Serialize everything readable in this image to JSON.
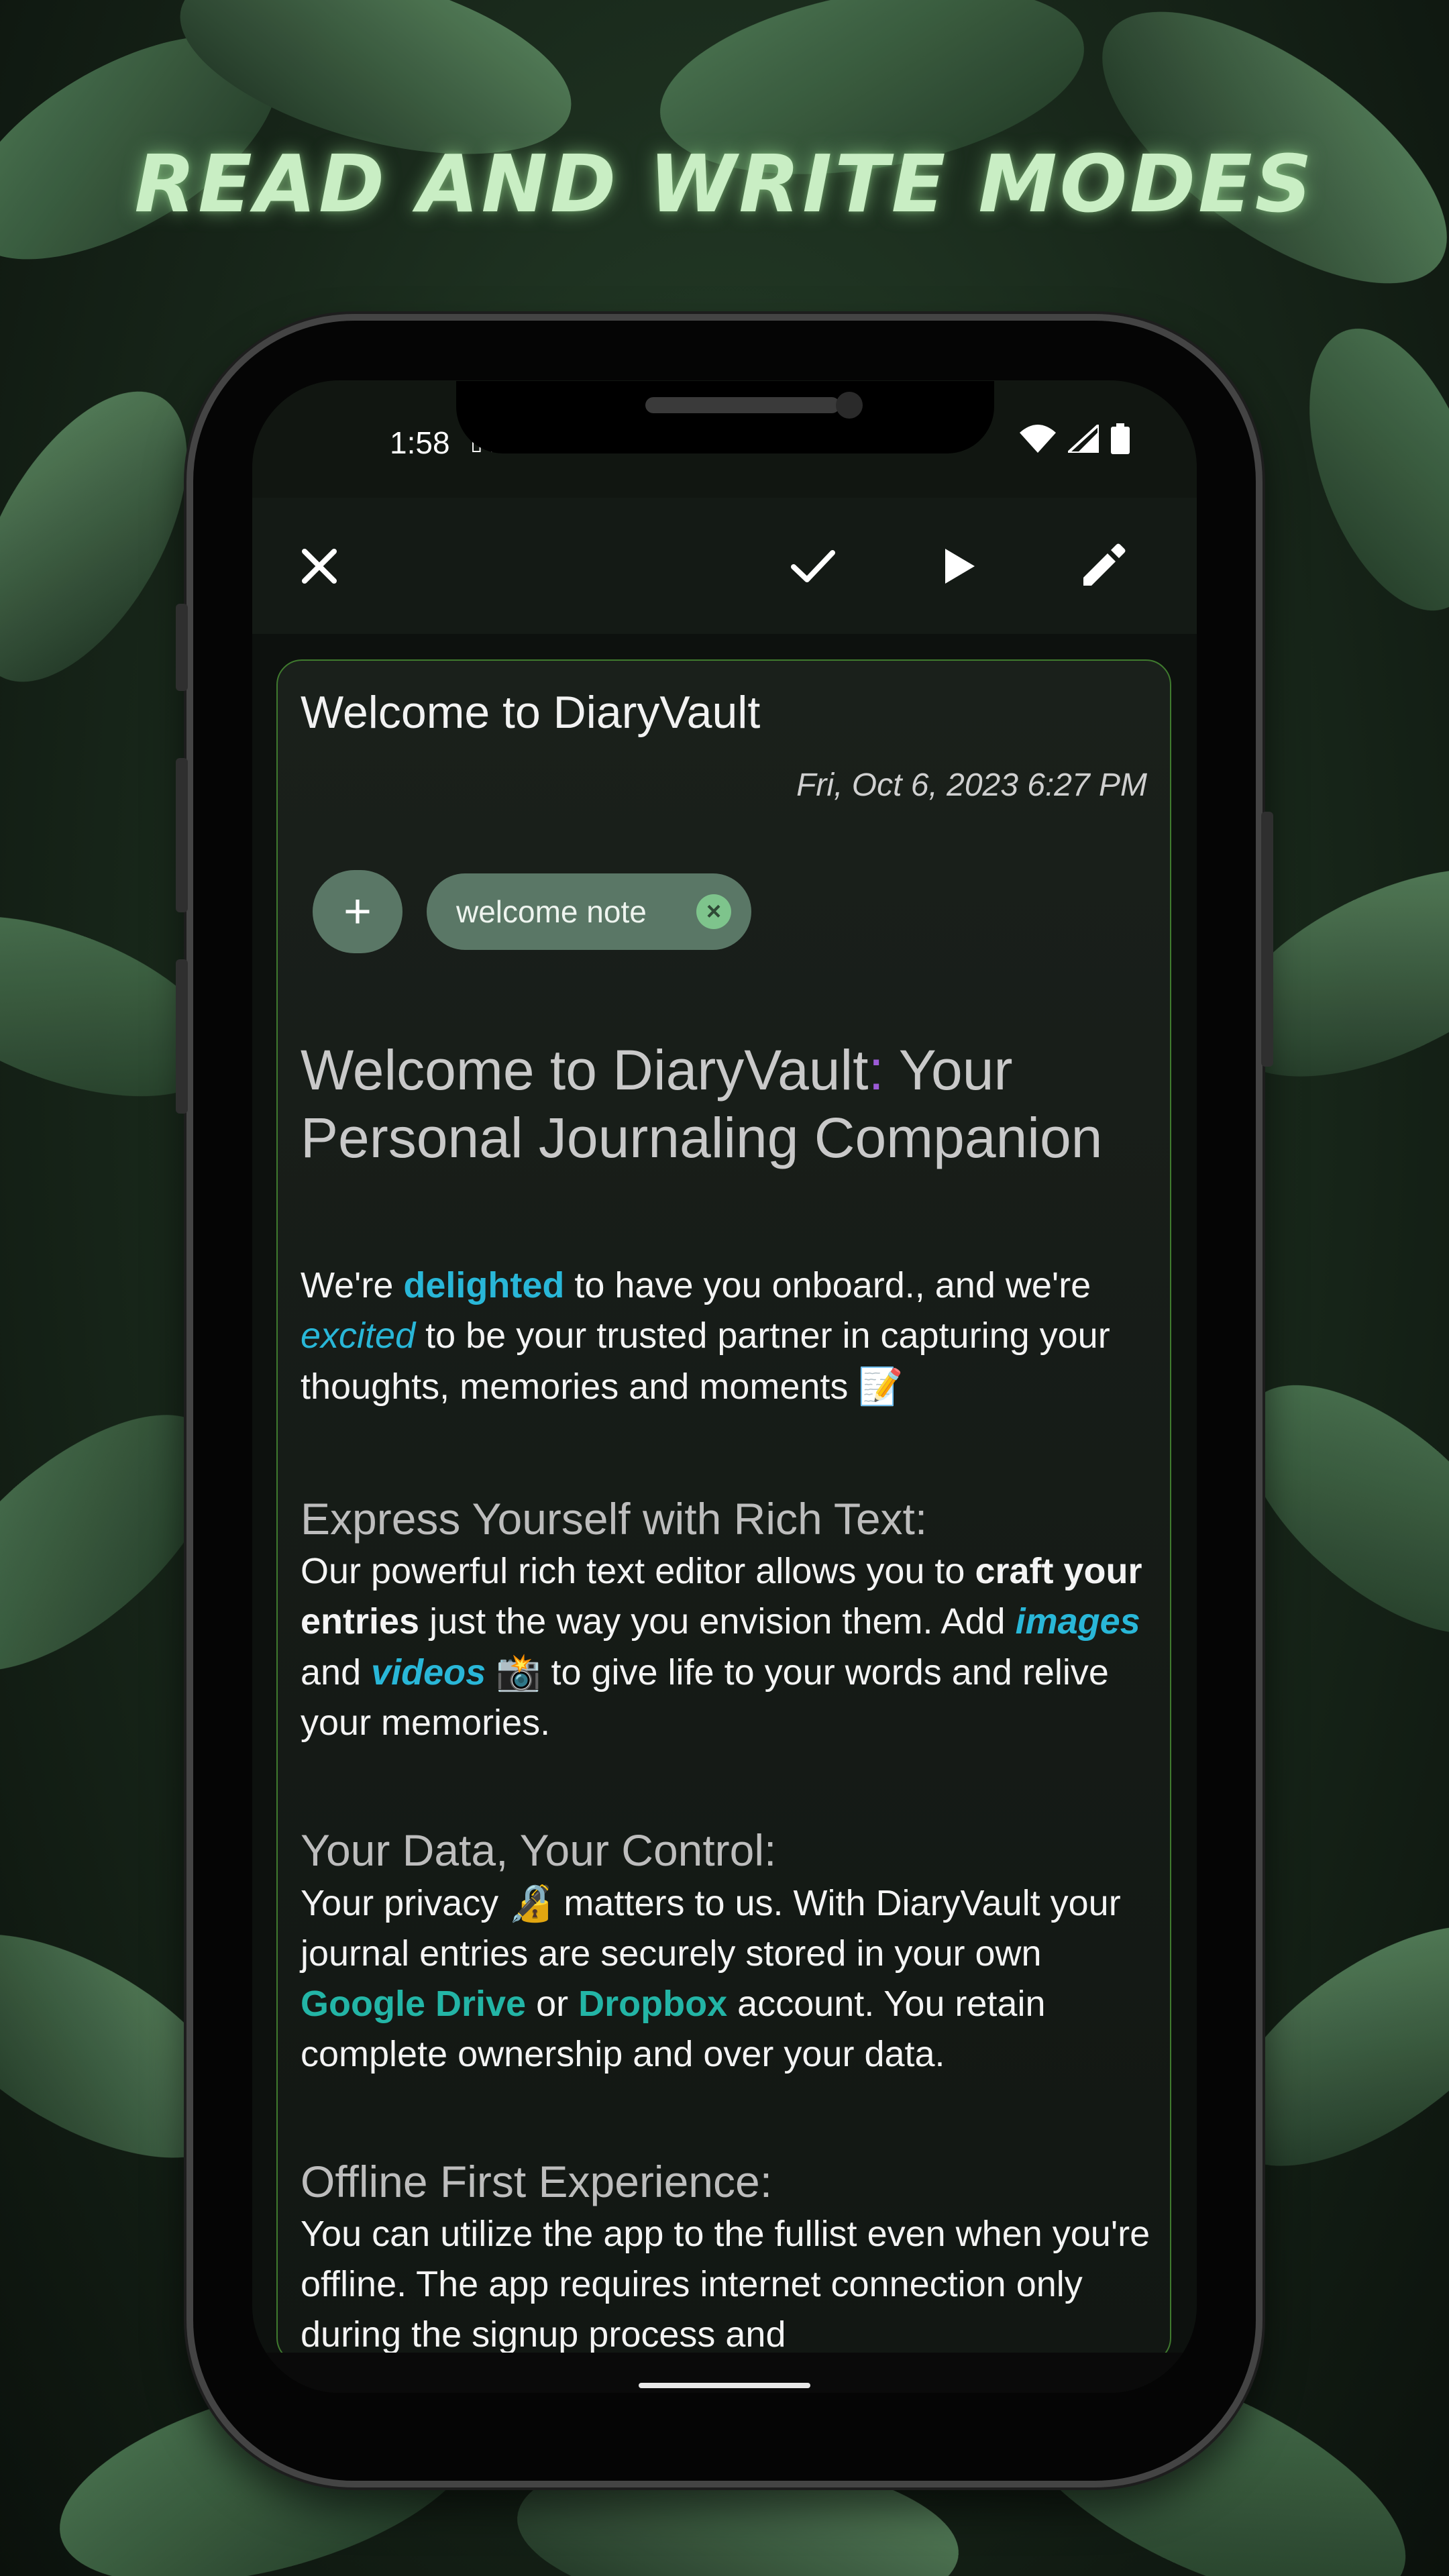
{
  "headline": "READ AND WRITE MODES",
  "status": {
    "time": "1:58",
    "extra": "▯ ▯"
  },
  "toolbar": {
    "close_icon": "close-icon",
    "check_icon": "check-icon",
    "play_icon": "play-icon",
    "edit_icon": "edit-icon"
  },
  "entry": {
    "title": "Welcome to DiaryVault",
    "date": "Fri, Oct 6, 2023  6:27 PM",
    "add_tag_label": "+",
    "tag": "welcome note",
    "tag_remove": "×"
  },
  "doc": {
    "h1_a": "Welcome to DiaryVault",
    "h1_colon": ":",
    "h1_b": " Your Personal Journaling Companion",
    "p1": {
      "a": "We're ",
      "b": "delighted",
      "c": " to have you onboard., and we're ",
      "d": "excited",
      "e": " to be your trusted partner in capturing your thoughts, memories and moments ",
      "emoji": "📝"
    },
    "s2_heading": "Express Yourself with Rich Text:",
    "p2": {
      "a": "Our powerful rich text editor allows you to ",
      "b": "craft your entries",
      "c": " just the way you envision them. Add ",
      "d": "images",
      "e": " and ",
      "f": "videos",
      "emoji": "📸",
      "g": " to give life to your words and relive your memories."
    },
    "s3_heading": "Your Data, Your Control:",
    "p3": {
      "a": "Your privacy ",
      "emoji": "🔏",
      "b": " matters to us. With DiaryVault your journal entries are securely stored in your own ",
      "c": "Google Drive",
      "d": " or ",
      "e": "Dropbox",
      "f": " account. You retain complete ownership and over your data."
    },
    "s4_heading": "Offline First Experience:",
    "p4": "You can utilize the app to the fullist even when you're offline. The app requires internet connection only during the signup process and"
  },
  "colors": {
    "accent": "#29b7d8",
    "link": "#23b5a6",
    "card_border": "#3f7a2e",
    "chip": "#5a7766"
  }
}
